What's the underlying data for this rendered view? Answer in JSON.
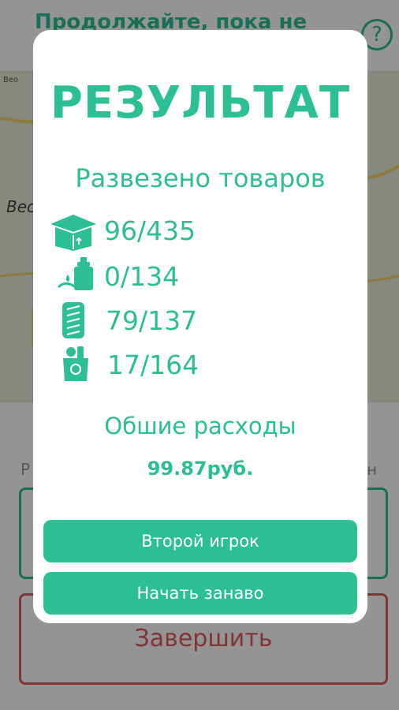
{
  "background": {
    "header_text": "Продолжайте, пока не",
    "help_label": "?",
    "map_label": "Вес",
    "map_corner_text": "Beo",
    "side_text_left": "Р",
    "side_text_right": "ин",
    "finish_label": "Завершить"
  },
  "modal": {
    "title": "РЕЗУЛЬТАТ",
    "subtitle": "Развезено товаров",
    "rows": [
      {
        "icon": "package-icon",
        "value": "96/435"
      },
      {
        "icon": "hand-sanitizer-icon",
        "value": "0/134"
      },
      {
        "icon": "phone-icon",
        "value": "79/137"
      },
      {
        "icon": "grocery-bag-icon",
        "value": "17/164"
      }
    ],
    "expenses_label": "Обшие расходы",
    "expenses_value": "99.87",
    "expenses_currency": "руб.",
    "button_second_player": "Второй игрок",
    "button_restart": "Начать занаво"
  },
  "colors": {
    "accent": "#2cbf94",
    "danger": "#e05a5a"
  }
}
